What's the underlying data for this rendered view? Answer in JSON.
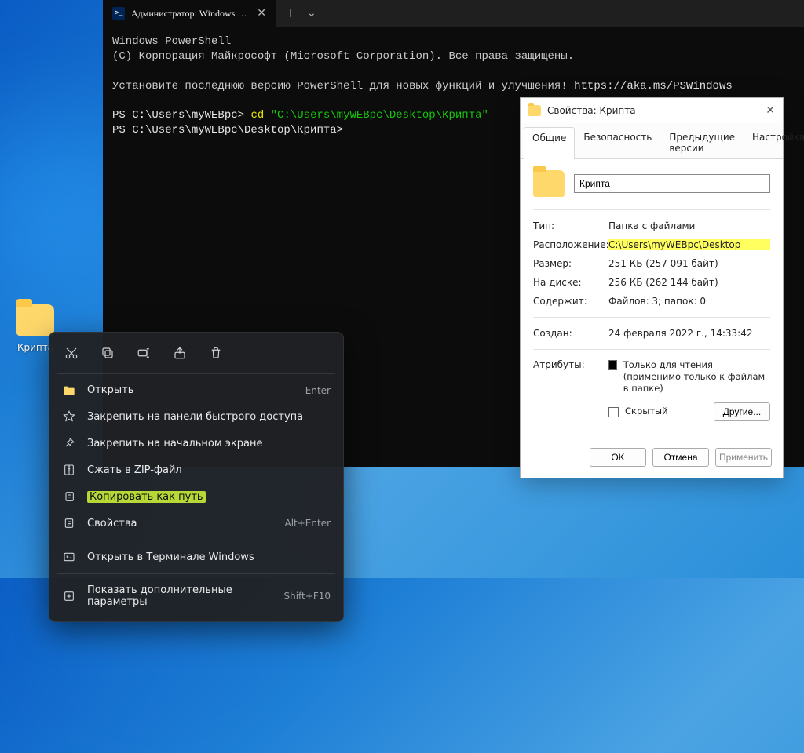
{
  "desktop": {
    "folder_label": "Крипта"
  },
  "terminal": {
    "tab_title": "Администратор: Windows Pow",
    "lines": {
      "l1": "Windows PowerShell",
      "l2": "(C) Корпорация Майкрософт (Microsoft Corporation). Все права защищены.",
      "l3a": "Установите последнюю версию PowerShell для новых функций и улучшения! ",
      "l3b": "https://aka.ms/PSWindows",
      "p1": "PS C:\\Users\\myWEBpc> ",
      "p1cmd": "cd ",
      "p1arg": "\"C:\\Users\\myWEBpc\\Desktop\\Крипта\"",
      "p2": "PS C:\\Users\\myWEBpc\\Desktop\\Крипта>"
    }
  },
  "props": {
    "title": "Свойства: Крипта",
    "tabs": {
      "general": "Общие",
      "security": "Безопасность",
      "prev": "Предыдущие версии",
      "custom": "Настройка"
    },
    "name_value": "Крипта",
    "rows": {
      "type_k": "Тип:",
      "type_v": "Папка с файлами",
      "loc_k": "Расположение:",
      "loc_v": "C:\\Users\\myWEBpc\\Desktop",
      "size_k": "Размер:",
      "size_v": "251 КБ (257 091 байт)",
      "disk_k": "На диске:",
      "disk_v": "256 КБ (262 144 байт)",
      "cont_k": "Содержит:",
      "cont_v": "Файлов: 3; папок: 0",
      "created_k": "Создан:",
      "created_v": "24 февраля 2022 г., 14:33:42",
      "attr_k": "Атрибуты:",
      "readonly": "Только для чтения",
      "readonly_note": "(применимо только к файлам в папке)",
      "hidden": "Скрытый",
      "other_btn": "Другие..."
    },
    "footer": {
      "ok": "OK",
      "cancel": "Отмена",
      "apply": "Применить"
    }
  },
  "context": {
    "items": {
      "open": "Открыть",
      "open_sc": "Enter",
      "pin_quick": "Закрепить на панели быстрого доступа",
      "pin_start": "Закрепить на начальном экране",
      "zip": "Сжать в ZIP-файл",
      "copy_path": "Копировать как путь",
      "props": "Свойства",
      "props_sc": "Alt+Enter",
      "open_term": "Открыть в Терминале Windows",
      "more": "Показать дополнительные параметры",
      "more_sc": "Shift+F10"
    }
  }
}
